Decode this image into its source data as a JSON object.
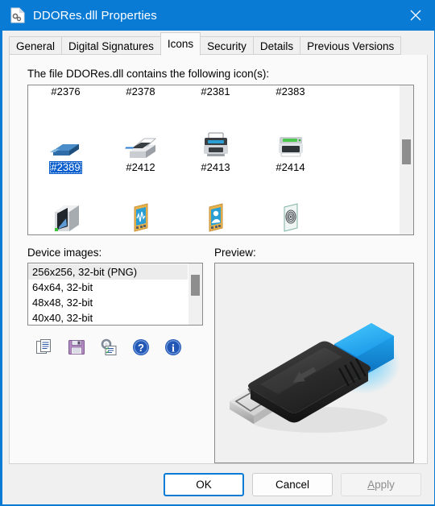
{
  "window": {
    "title": "DDORes.dll Properties",
    "title_icon": "dll-file-icon",
    "close_icon": "close-icon",
    "accent_color": "#0a7bd4"
  },
  "tabs": [
    {
      "label": "General",
      "selected": false
    },
    {
      "label": "Digital Signatures",
      "selected": false
    },
    {
      "label": "Icons",
      "selected": true
    },
    {
      "label": "Security",
      "selected": false
    },
    {
      "label": "Details",
      "selected": false
    },
    {
      "label": "Previous Versions",
      "selected": false
    }
  ],
  "icons_tab": {
    "contains_label": "The file DDORes.dll contains the following icon(s):",
    "grid_rows": [
      {
        "partial": true,
        "cells": [
          {
            "label": "#2376",
            "icon": "usb-flash-drive-icon",
            "selected": false
          },
          {
            "label": "#2378",
            "icon": "fax-machine-icon",
            "selected": false
          },
          {
            "label": "#2381",
            "icon": "printer-icon",
            "selected": false
          },
          {
            "label": "#2383",
            "icon": "printer-green-icon",
            "selected": false
          }
        ]
      },
      {
        "partial": false,
        "cells": [
          {
            "label": "#2389",
            "icon": "usb-flash-drive-blue-icon",
            "selected": true
          },
          {
            "label": "#2412",
            "icon": "fax-printer-icon",
            "selected": false
          },
          {
            "label": "#2413",
            "icon": "inkjet-printer-icon",
            "selected": false
          },
          {
            "label": "#2414",
            "icon": "laser-printer-icon",
            "selected": false
          }
        ]
      },
      {
        "clipped": true,
        "cells": [
          {
            "label": "",
            "icon": "3d-printer-icon",
            "selected": false
          },
          {
            "label": "",
            "icon": "medical-monitor-icon",
            "selected": false
          },
          {
            "label": "",
            "icon": "biometric-scanner-icon",
            "selected": false
          },
          {
            "label": "",
            "icon": "fingerprint-reader-icon",
            "selected": false
          }
        ]
      }
    ],
    "grid_scrollbar": {
      "thumb_top_pct": 36,
      "thumb_height_pct": 17
    },
    "device_images": {
      "label": "Device images:",
      "items": [
        {
          "text": "256x256, 32-bit (PNG)",
          "selected": true
        },
        {
          "text": "64x64, 32-bit",
          "selected": false
        },
        {
          "text": "48x48, 32-bit",
          "selected": false
        },
        {
          "text": "40x40, 32-bit",
          "selected": false
        }
      ],
      "scrollbar": {
        "thumb_top_pct": 18,
        "thumb_height_pct": 34
      }
    },
    "toolbar": [
      {
        "name": "copy-icon",
        "title": "Copy"
      },
      {
        "name": "save-icon",
        "title": "Save"
      },
      {
        "name": "properties-icon",
        "title": "Properties"
      },
      {
        "name": "help-icon",
        "title": "Help"
      },
      {
        "name": "info-icon",
        "title": "Info"
      }
    ],
    "preview": {
      "label": "Preview:",
      "image": "usb-flash-drive-preview"
    }
  },
  "buttons": {
    "ok": "OK",
    "cancel": "Cancel",
    "apply_accel": "A",
    "apply_rest": "pply"
  }
}
